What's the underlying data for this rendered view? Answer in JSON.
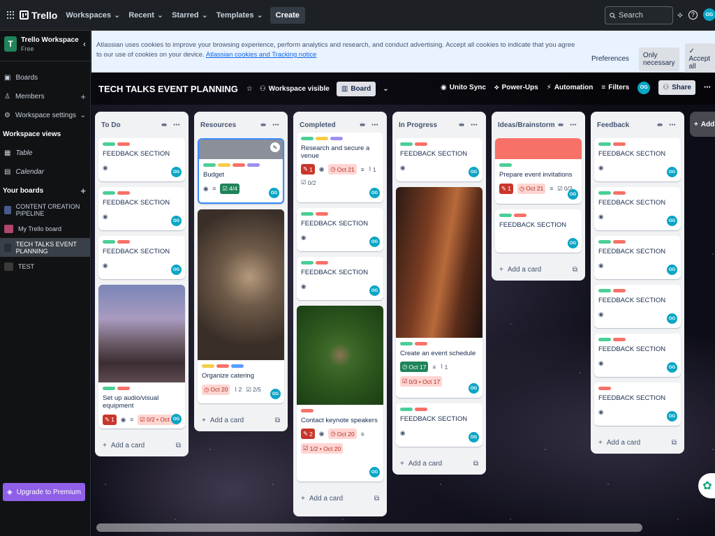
{
  "topbar": {
    "app_name": "Trello",
    "nav": [
      "Workspaces",
      "Recent",
      "Starred",
      "Templates"
    ],
    "create": "Create",
    "search_placeholder": "Search",
    "avatar": "OG"
  },
  "sidebar": {
    "workspace_initial": "T",
    "workspace_name": "Trello Workspace",
    "workspace_plan": "Free",
    "items": [
      {
        "label": "Boards"
      },
      {
        "label": "Members"
      },
      {
        "label": "Workspace settings"
      }
    ],
    "views_title": "Workspace views",
    "views": [
      {
        "label": "Table"
      },
      {
        "label": "Calendar"
      }
    ],
    "boards_title": "Your boards",
    "boards": [
      {
        "label": "CONTENT CREATION PIPELINE",
        "color": "#4a5a8a"
      },
      {
        "label": "My Trello board",
        "color": "#b0456e"
      },
      {
        "label": "TECH TALKS EVENT PLANNING",
        "color": "#2a2d3a"
      },
      {
        "label": "TEST",
        "color": "#3a3a3a"
      }
    ],
    "premium": "Upgrade to Premium"
  },
  "cookie": {
    "text": "Atlassian uses cookies to improve your browsing experience, perform analytics and research, and conduct advertising. Accept all cookies to indicate that you agree to our use of cookies on your device.",
    "link": "Atlassian cookies and Tracking notice",
    "preferences": "Preferences",
    "only_necessary": "Only necessary",
    "accept_all": "Accept all"
  },
  "board": {
    "title": "TECH TALKS EVENT PLANNING",
    "visibility": "Workspace visible",
    "view": "Board",
    "unito": "Unito Sync",
    "powerups": "Power-Ups",
    "automation": "Automation",
    "filters": "Filters",
    "share": "Share",
    "add_list": "Add a"
  },
  "lists": {
    "todo": {
      "title": "To Do",
      "cards": [
        {
          "title": "FEEDBACK SECTION"
        },
        {
          "title": "FEEDBACK SECTION"
        },
        {
          "title": "FEEDBACK SECTION"
        },
        {
          "title": "Set up audio/visual equipment",
          "comments": "1",
          "checklist": "0/2 • Oct 21"
        }
      ],
      "add": "Add a card"
    },
    "resources": {
      "title": "Resources",
      "cards": [
        {
          "title": "Budget",
          "checklist": "4/4"
        },
        {
          "title": "Organize catering",
          "date": "Oct 20",
          "attachments": "2",
          "checklist": "2/5"
        }
      ],
      "add": "Add a card"
    },
    "completed": {
      "title": "Completed",
      "cards": [
        {
          "title": "Research and secure a venue",
          "comments": "1",
          "date": "Oct 21",
          "attachments": "1",
          "checklist": "0/2"
        },
        {
          "title": "FEEDBACK SECTION"
        },
        {
          "title": "FEEDBACK SECTION"
        },
        {
          "title": "Contact keynote speakers",
          "comments": "2",
          "date": "Oct 20",
          "checklist": "1/2 • Oct 20"
        }
      ],
      "add": "Add a card"
    },
    "progress": {
      "title": "In Progress",
      "cards": [
        {
          "title": "FEEDBACK SECTION"
        },
        {
          "title": "Create an event schedule",
          "date": "Oct 17",
          "attachments": "1",
          "checklist": "0/3 • Oct 17"
        },
        {
          "title": "FEEDBACK SECTION"
        }
      ],
      "add": "Add a card"
    },
    "ideas": {
      "title": "Ideas/Brainstorm",
      "cards": [
        {
          "title": "Prepare event invitations",
          "comments": "1",
          "date": "Oct 21",
          "checklist": "0/2"
        },
        {
          "title": "FEEDBACK SECTION"
        }
      ],
      "add": "Add a card"
    },
    "feedback": {
      "title": "Feedback",
      "cards": [
        {
          "title": "FEEDBACK SECTION"
        },
        {
          "title": "FEEDBACK SECTION"
        },
        {
          "title": "FEEDBACK SECTION"
        },
        {
          "title": "FEEDBACK SECTION"
        },
        {
          "title": "FEEDBACK SECTION"
        },
        {
          "title": "FEEDBACK SECTION"
        }
      ],
      "add": "Add a card"
    }
  },
  "member_initials": "OG"
}
